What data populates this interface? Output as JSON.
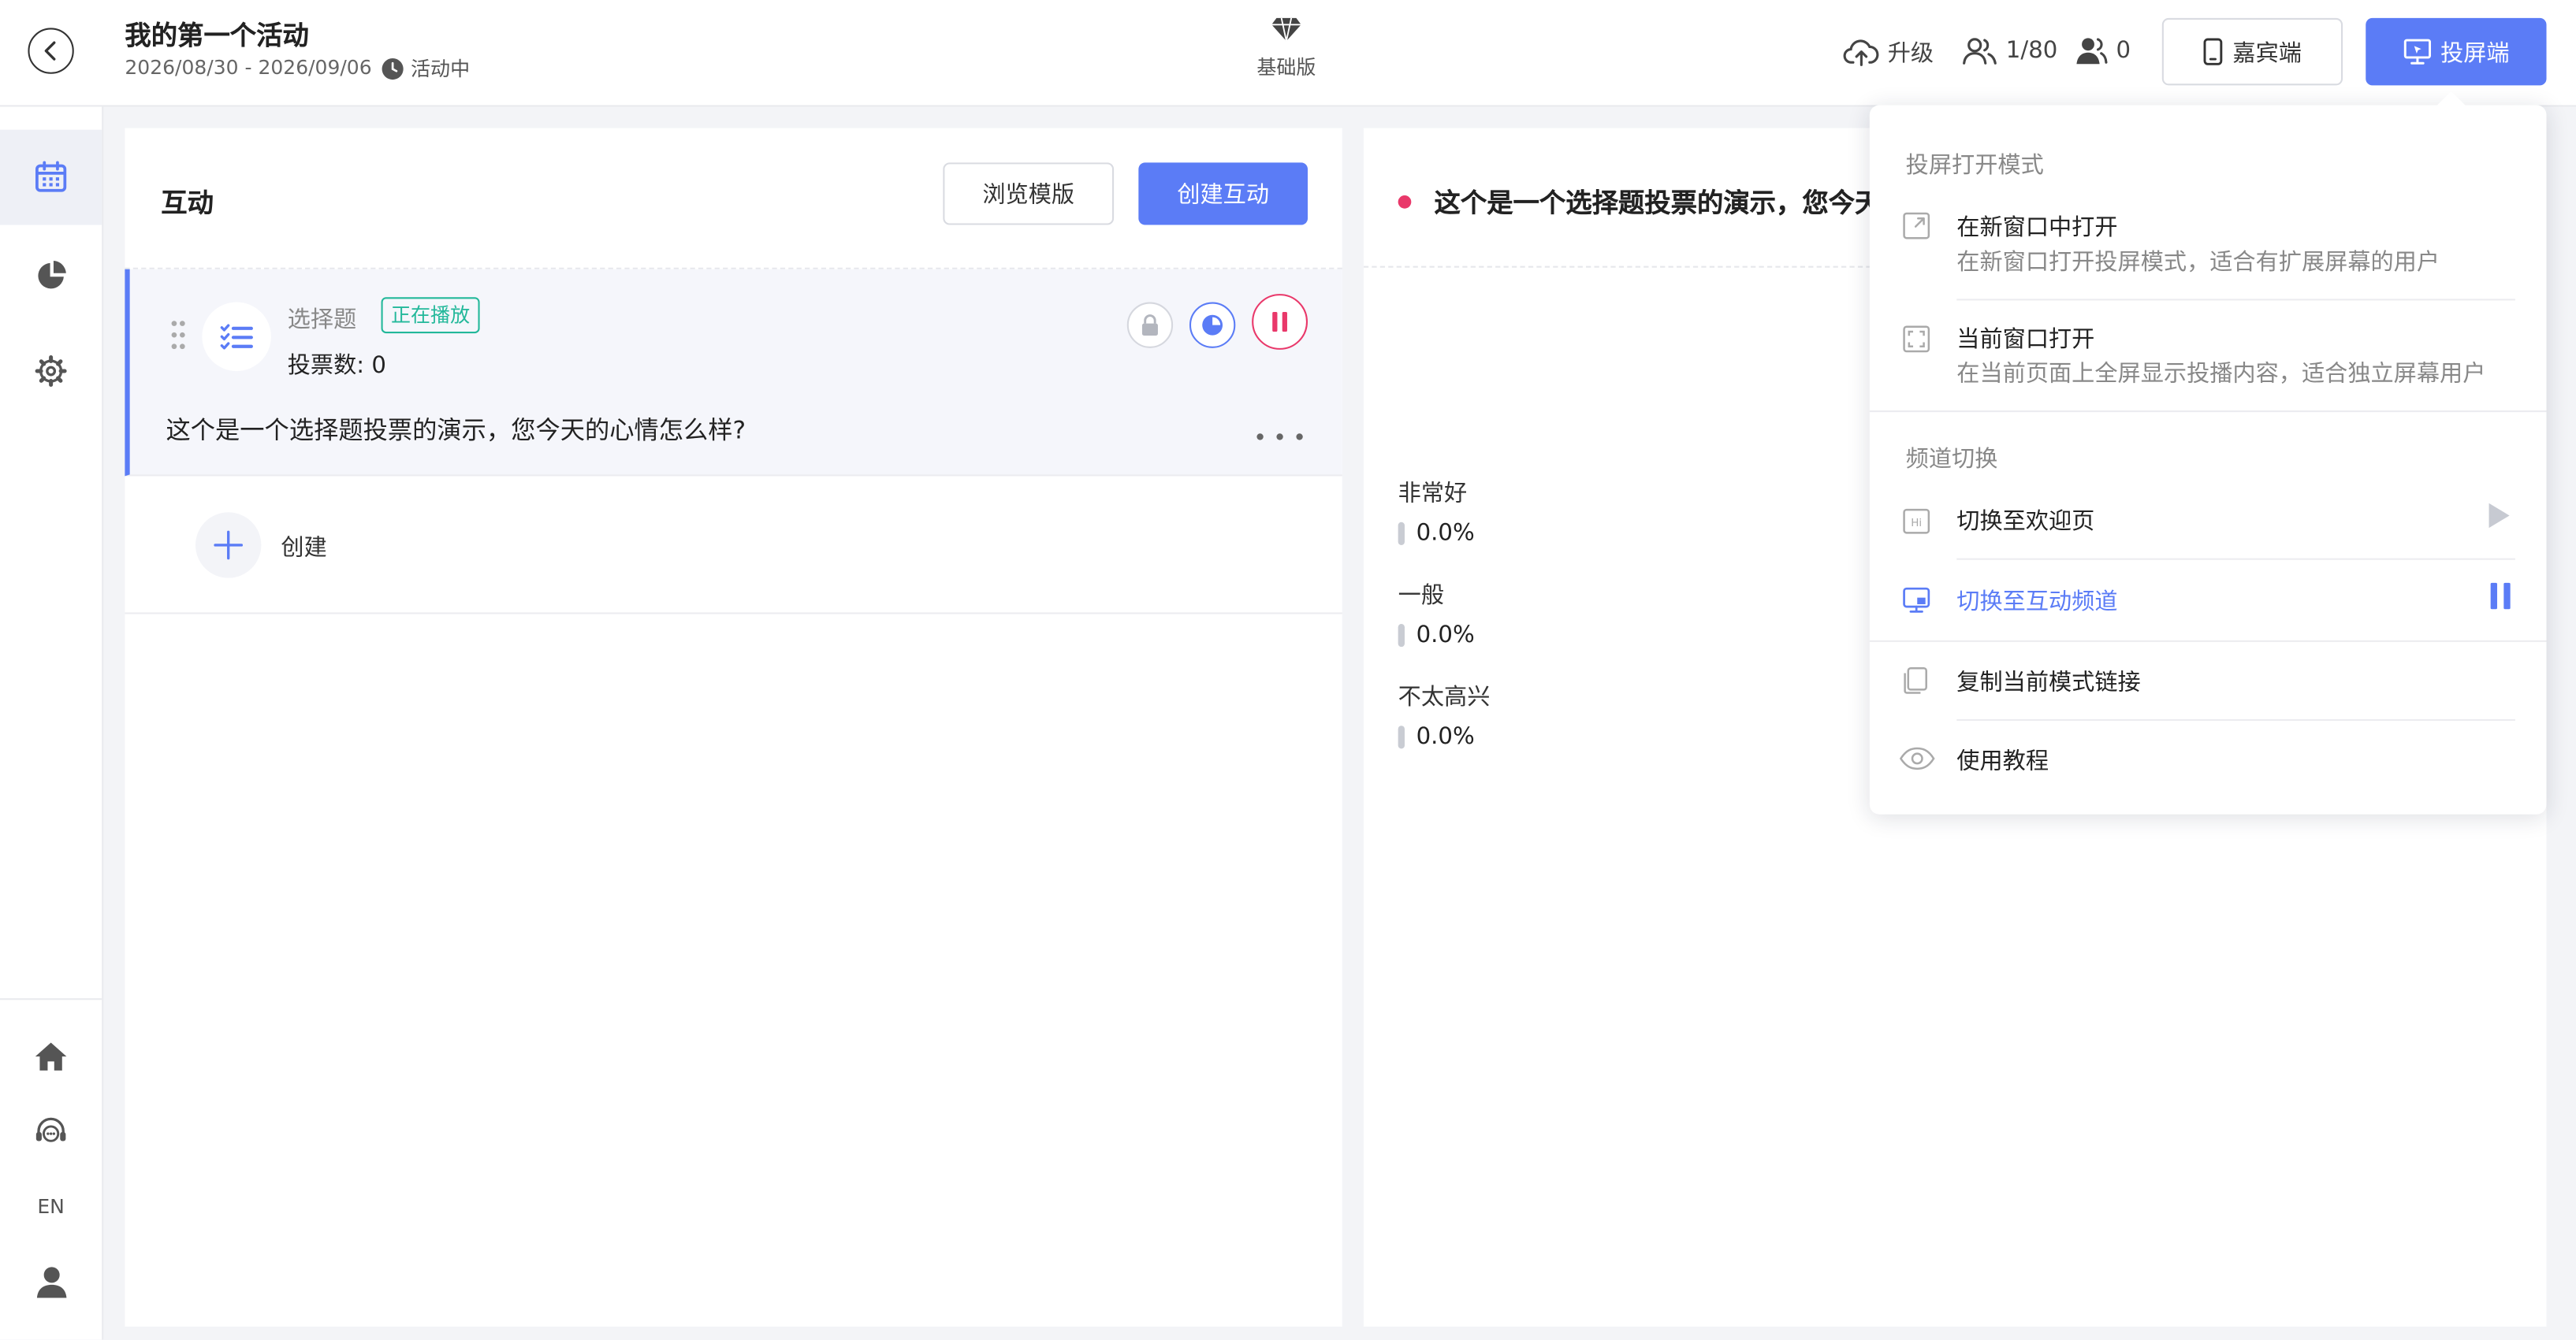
{
  "header": {
    "title": "我的第一个活动",
    "dates": "2026/08/30 - 2026/09/06",
    "status": "活动中",
    "plan": "基础版",
    "upgrade_label": "升级",
    "seats": "1/80",
    "online": "0",
    "guest_label": "嘉宾端",
    "screen_label": "投屏端"
  },
  "sidebar": {
    "lang_label": "EN"
  },
  "left_panel": {
    "title": "互动",
    "browse_label": "浏览模版",
    "create_label": "创建互动",
    "item": {
      "type": "选择题",
      "badge": "正在播放",
      "vote_count": "投票数: 0",
      "question": "这个是一个选择题投票的演示，您今天的心情怎么样?"
    },
    "create_row_label": "创建"
  },
  "right_panel": {
    "title": "这个是一个选择题投票的演示，您今天的心情怎么样?",
    "options": [
      {
        "label": "非常好",
        "percent": "0.0%"
      },
      {
        "label": "一般",
        "percent": "0.0%"
      },
      {
        "label": "不太高兴",
        "percent": "0.0%"
      }
    ]
  },
  "dropdown": {
    "open_mode_header": "投屏打开模式",
    "new_window_title": "在新窗口中打开",
    "new_window_desc": "在新窗口打开投屏模式，适合有扩展屏幕的用户",
    "current_window_title": "当前窗口打开",
    "current_window_desc": "在当前页面上全屏显示投播内容，适合独立屏幕用户",
    "channel_header": "频道切换",
    "channel_welcome": "切换至欢迎页",
    "channel_interactive": "切换至互动频道",
    "copy_link": "复制当前模式链接",
    "tutorial": "使用教程"
  },
  "colors": {
    "accent": "#5b7cf6",
    "live": "#e9386a",
    "badge": "#23b89a"
  }
}
